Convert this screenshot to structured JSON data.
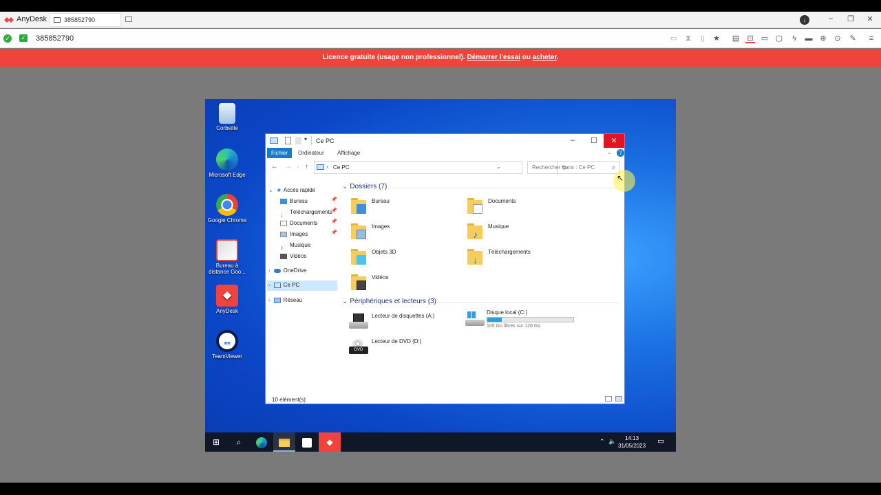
{
  "anydesk": {
    "app_name": "AnyDesk",
    "tab_label": "385852790",
    "address_id": "385852790",
    "accent": "#ef443b"
  },
  "banner": {
    "text": "Licence gratuite (usage non professionnel). ",
    "link1": "Démarrer l'essai",
    "middle": " ou ",
    "link2": "acheter",
    "end": "."
  },
  "desktop_icons": [
    {
      "label": "Corbeille",
      "icon": "recycle-bin-icon"
    },
    {
      "label": "Microsoft Edge",
      "icon": "edge-icon"
    },
    {
      "label": "Google Chrome",
      "icon": "chrome-icon"
    },
    {
      "label": "Bureau à distance Goo...",
      "icon": "remote-desktop-icon"
    },
    {
      "label": "AnyDesk",
      "icon": "anydesk-icon"
    },
    {
      "label": "TeamViewer",
      "icon": "teamviewer-icon"
    }
  ],
  "explorer": {
    "title": "Ce PC",
    "ribbon_tabs": [
      "Fichier",
      "Ordinateur",
      "Affichage"
    ],
    "address": "Ce PC",
    "search_placeholder": "Rechercher dans : Ce PC",
    "nav": {
      "quick_access": "Accès rapide",
      "items": [
        "Bureau",
        "Téléchargements",
        "Documents",
        "Images",
        "Musique",
        "Vidéos"
      ],
      "onedrive": "OneDrive",
      "this_pc": "Ce PC",
      "network": "Réseau"
    },
    "folders_header": "Dossiers (7)",
    "folders": [
      "Bureau",
      "Documents",
      "Images",
      "Musique",
      "Objets 3D",
      "Téléchargements",
      "Vidéos"
    ],
    "devices_header": "Périphériques et lecteurs (3)",
    "devices": {
      "floppy": "Lecteur de disquettes (A:)",
      "local_disk": "Disque local (C:)",
      "local_disk_free": "105 Go libres sur 126 Go",
      "dvd": "Lecteur de DVD (D:)"
    },
    "disk_usage_fraction": 0.17,
    "status": "10 élément(s)"
  },
  "taskbar": {
    "time": "14:13",
    "date": "31/05/2023"
  }
}
